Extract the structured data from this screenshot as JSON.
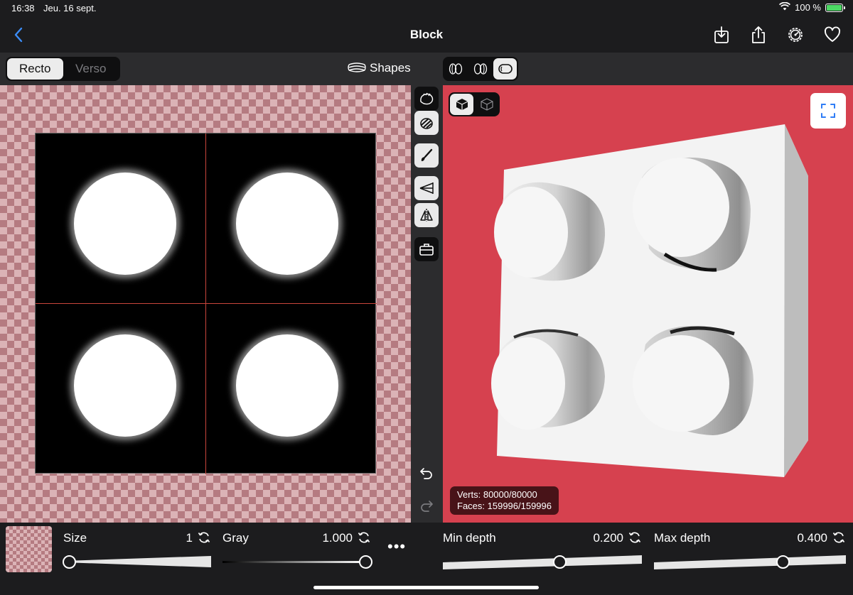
{
  "status_bar": {
    "time": "16:38",
    "date": "Jeu. 16 sept.",
    "battery_text": "100 %",
    "icons": [
      "wifi-icon",
      "battery-charging-icon"
    ]
  },
  "nav": {
    "title": "Block",
    "back_icon": "chevron-left-icon",
    "actions": [
      "download-icon",
      "share-icon",
      "settings-gear-icon",
      "heart-icon"
    ]
  },
  "toolbar": {
    "side_tabs": [
      {
        "label": "Recto",
        "active": true
      },
      {
        "label": "Verso",
        "active": false
      }
    ],
    "shapes_label": "Shapes",
    "shapes_icon": "stack-layers-icon",
    "view_modes": [
      {
        "icon": "double-relief-icon",
        "active": false
      },
      {
        "icon": "double-relief-alt-icon",
        "active": false
      },
      {
        "icon": "rounded-block-icon",
        "active": true
      }
    ]
  },
  "tools": [
    {
      "name": "emboss-tool-icon",
      "active": false
    },
    {
      "name": "texture-tool-icon",
      "active": true
    },
    {
      "name": "brush-tool-icon",
      "active": true
    },
    {
      "name": "gradient-tool-icon",
      "active": true
    },
    {
      "name": "mirror-tool-icon",
      "active": true
    },
    {
      "name": "toolbox-icon",
      "active": false
    }
  ],
  "history": {
    "undo_icon": "undo-icon",
    "redo_icon": "redo-icon"
  },
  "preview": {
    "render_modes": [
      {
        "icon": "solid-cube-icon",
        "active": true
      },
      {
        "icon": "wireframe-cube-icon",
        "active": false
      }
    ],
    "fullscreen_icon": "fullscreen-icon",
    "verts": "Verts: 80000/80000",
    "faces": "Faces: 159996/159996",
    "background_color": "#d6414f"
  },
  "controls": {
    "size": {
      "label": "Size",
      "value": "1",
      "position": 0.0
    },
    "gray": {
      "label": "Gray",
      "value": "1.000",
      "position": 1.0
    },
    "more_label": "•••",
    "min_depth": {
      "label": "Min depth",
      "value": "0.200",
      "position": 0.59
    },
    "max_depth": {
      "label": "Max depth",
      "value": "0.400",
      "position": 0.68
    }
  }
}
